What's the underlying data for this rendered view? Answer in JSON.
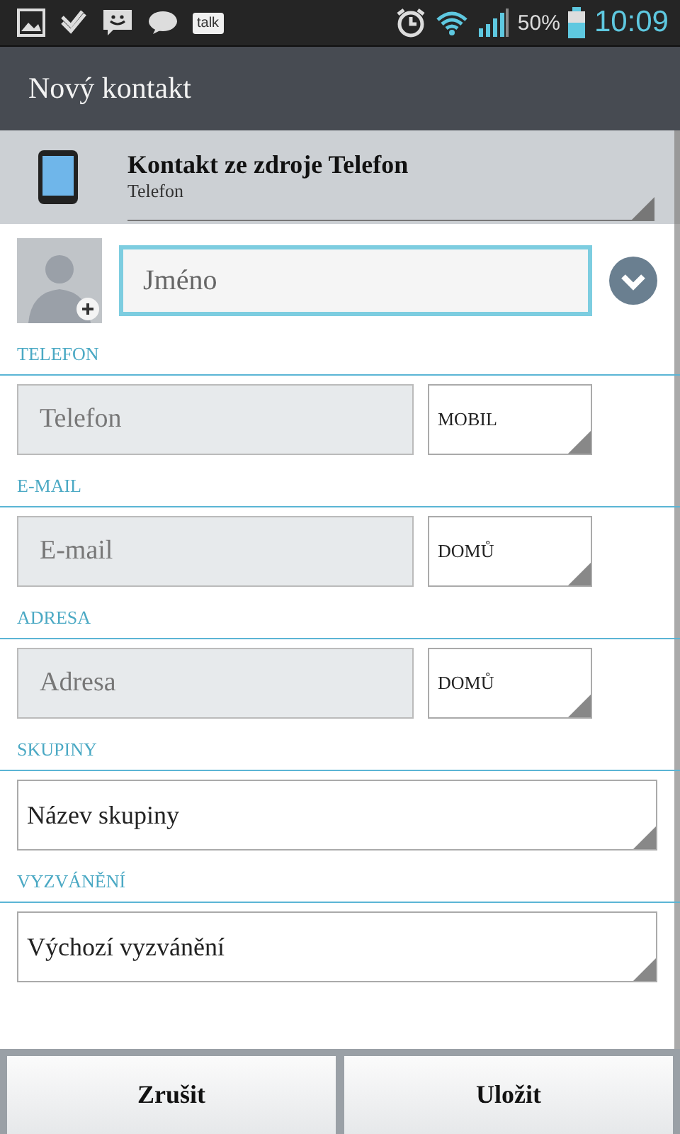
{
  "status_bar": {
    "talk_label": "talk",
    "battery": "50%",
    "time": "10:09"
  },
  "title": "Nový kontakt",
  "account": {
    "title": "Kontakt ze zdroje Telefon",
    "subtitle": "Telefon"
  },
  "name_field": {
    "placeholder": "Jméno",
    "focused": true
  },
  "sections": [
    {
      "label": "TELEFON",
      "kind": "typed",
      "placeholder": "Telefon",
      "type": "MOBIL"
    },
    {
      "label": "E-MAIL",
      "kind": "typed",
      "placeholder": "E-mail",
      "type": "DOMŮ"
    },
    {
      "label": "ADRESA",
      "kind": "typed",
      "placeholder": "Adresa",
      "type": "DOMŮ"
    },
    {
      "label": "SKUPINY",
      "kind": "spinner",
      "value": "Název skupiny"
    },
    {
      "label": "VYZVÁNĚNÍ",
      "kind": "spinner",
      "value": "Výchozí vyzvánění"
    }
  ],
  "buttons": [
    "Zrušit",
    "Uložit"
  ]
}
